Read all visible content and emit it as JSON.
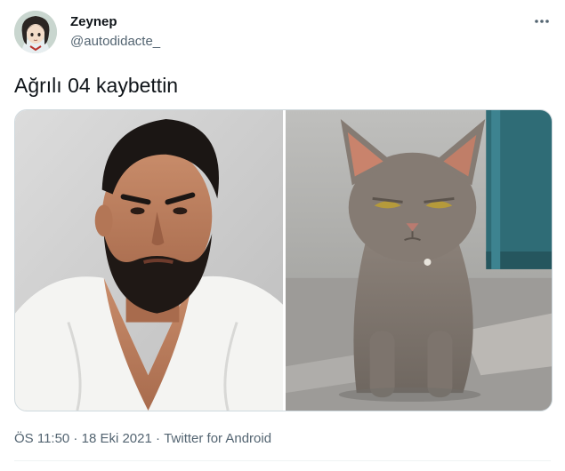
{
  "tweet": {
    "display_name": "Zeynep",
    "handle": "@autodidacte_",
    "text": "Ağrılı 04 kaybettin",
    "time": "ÖS 11:50",
    "separator": " · ",
    "date": "18 Eki 2021",
    "source": "Twitter for Android"
  },
  "icons": {
    "avatar": "anime-girl-avatar",
    "more": "more-options-icon"
  },
  "colors": {
    "text": "#0f1419",
    "muted": "#536471",
    "border": "#cfd9de"
  }
}
